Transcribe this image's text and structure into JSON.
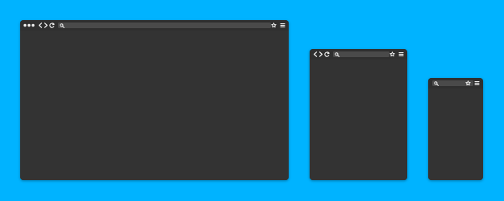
{
  "colors": {
    "background": "#00b3ff",
    "window": "#333333",
    "toolbar": "#2f2f2f",
    "urlbar": "#4a4a4a",
    "icon": "#f2f2f2"
  },
  "windows": [
    {
      "name": "desktop",
      "controls": [
        "window-dots",
        "back-icon",
        "forward-icon",
        "reload-icon",
        "search-icon",
        "star-icon",
        "menu-icon"
      ]
    },
    {
      "name": "tablet",
      "controls": [
        "back-icon",
        "forward-icon",
        "reload-icon",
        "search-icon",
        "star-icon",
        "menu-icon"
      ]
    },
    {
      "name": "phone",
      "controls": [
        "search-icon",
        "star-icon",
        "menu-icon"
      ]
    }
  ]
}
